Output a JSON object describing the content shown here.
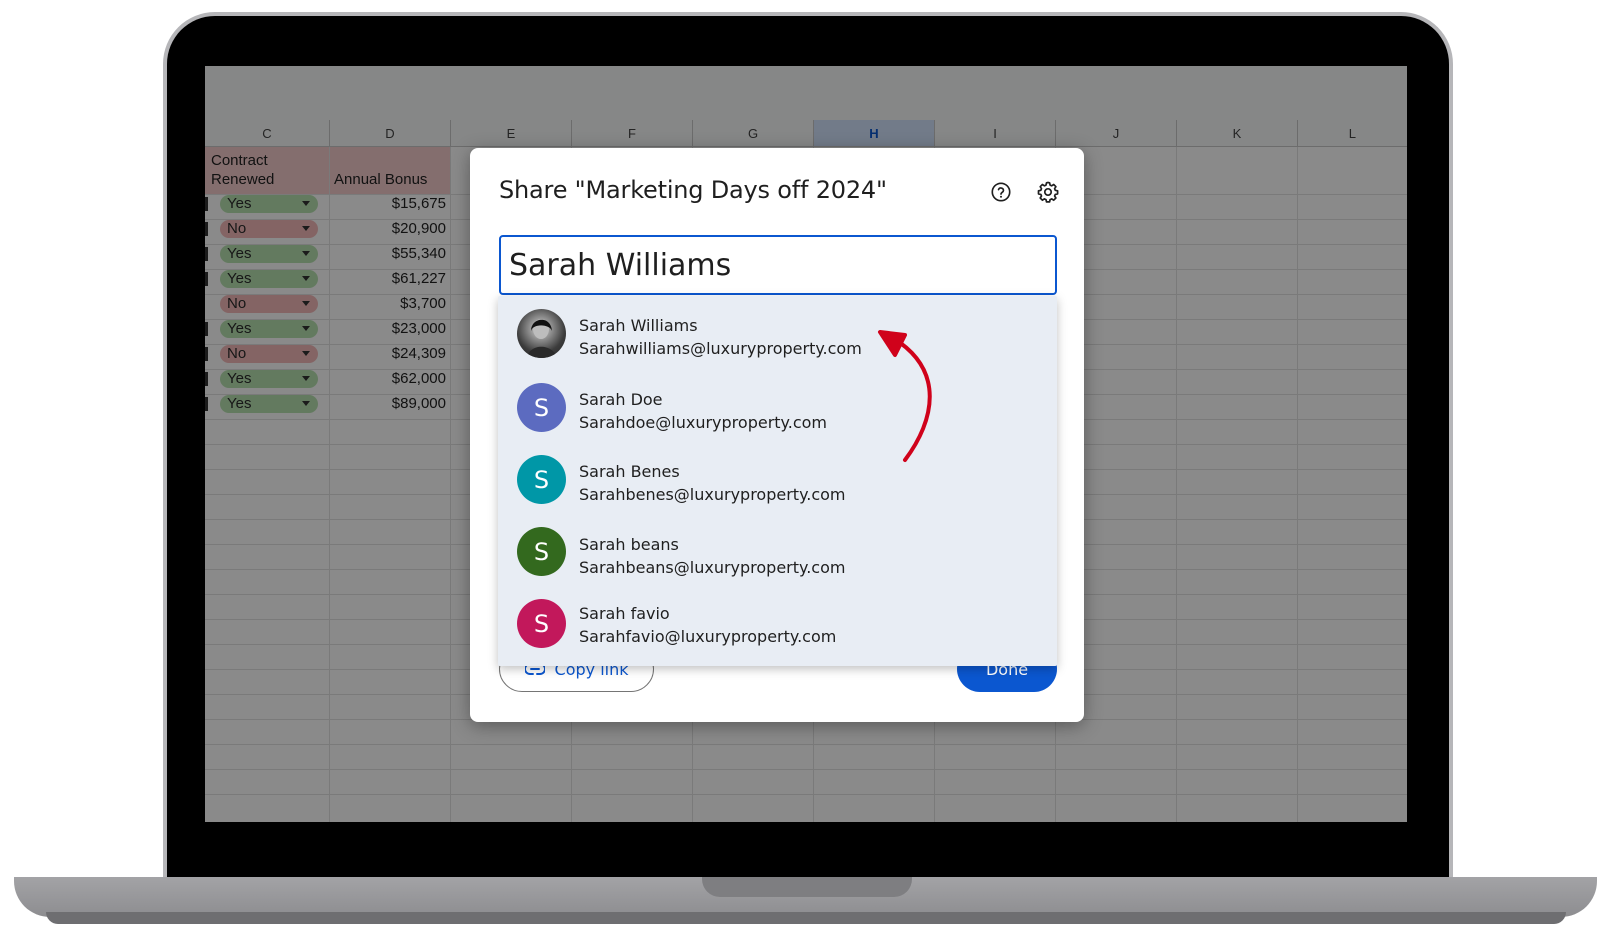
{
  "sheet": {
    "columns": [
      "C",
      "D",
      "E",
      "F",
      "G",
      "H",
      "I",
      "J",
      "K",
      "L"
    ],
    "selected_column": "H",
    "header_c": "Contract Renewed",
    "header_d": "Annual Bonus",
    "rows": [
      {
        "renewed": "Yes",
        "bonus": "$15,675"
      },
      {
        "renewed": "No",
        "bonus": "$20,900"
      },
      {
        "renewed": "Yes",
        "bonus": "$55,340"
      },
      {
        "renewed": "Yes",
        "bonus": "$61,227"
      },
      {
        "renewed": "No",
        "bonus": "$3,700"
      },
      {
        "renewed": "Yes",
        "bonus": "$23,000"
      },
      {
        "renewed": "No",
        "bonus": "$24,309"
      },
      {
        "renewed": "Yes",
        "bonus": "$62,000"
      },
      {
        "renewed": "Yes",
        "bonus": "$89,000"
      }
    ]
  },
  "dialog": {
    "title": "Share \"Marketing Days off 2024\"",
    "help_icon": "help-icon",
    "settings_icon": "gear-icon",
    "search_value": "Sarah Williams",
    "copy_link_label": "Copy link",
    "done_label": "Done"
  },
  "suggestions": [
    {
      "name": "Sarah Williams",
      "email": "Sarahwilliams@luxuryproperty.com",
      "initial": "",
      "color": "#4a4a4a",
      "photo": true
    },
    {
      "name": "Sarah Doe",
      "email": "Sarahdoe@luxuryproperty.com",
      "initial": "S",
      "color": "#5c6bc0"
    },
    {
      "name": "Sarah Benes",
      "email": "Sarahbenes@luxuryproperty.com",
      "initial": "S",
      "color": "#0097a7"
    },
    {
      "name": "Sarah beans",
      "email": "Sarahbeans@luxuryproperty.com",
      "initial": "S",
      "color": "#33691e"
    },
    {
      "name": "Sarah favio",
      "email": "Sarahfavio@luxuryproperty.com",
      "initial": "S",
      "color": "#c2185b"
    }
  ],
  "annotation": {
    "arrow_color": "#d0021b"
  }
}
